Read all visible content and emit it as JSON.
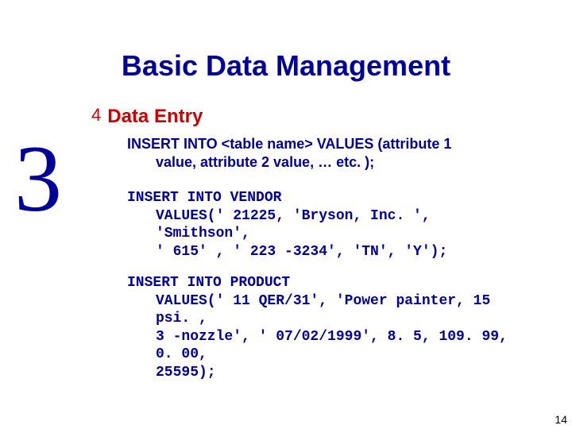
{
  "title": "Basic Data Management",
  "chapter_number": "3",
  "bullet": {
    "glyph": "4",
    "label": "Data Entry"
  },
  "syntax": {
    "line1": "INSERT INTO <table name> VALUES (attribute 1",
    "line2": "value, attribute 2 value, … etc. );"
  },
  "code_vendor": {
    "l1": "INSERT INTO VENDOR",
    "l2": "VALUES(' 21225, 'Bryson, Inc. ', 'Smithson',",
    "l3": "' 615' , ' 223 -3234', 'TN', 'Y');"
  },
  "code_product": {
    "l1": "INSERT INTO PRODUCT",
    "l2": "VALUES(' 11 QER/31', 'Power painter, 15 psi. ,",
    "l3": "3 -nozzle', ' 07/02/1999', 8. 5, 109. 99, 0. 00,",
    "l4": "25595);"
  },
  "page_number": "14"
}
